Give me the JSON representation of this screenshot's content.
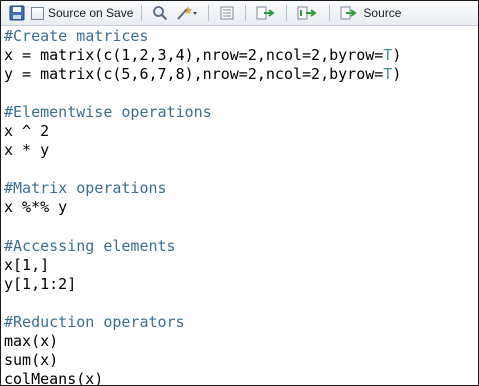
{
  "toolbar": {
    "save_icon": "save-disk-icon",
    "source_on_save_label": "Source on Save",
    "source_on_save_checked": false,
    "search_icon": "magnifier-icon",
    "magic_wand_icon": "magic-wand-icon",
    "outline_icon": "document-outline-icon",
    "run_icon": "run-lines-icon",
    "rerun_icon": "rerun-icon",
    "source_label": "Source"
  },
  "editor": {
    "lines": [
      "#Create matrices",
      "x = matrix(c(1,2,3,4),nrow=2,ncol=2,byrow=T)",
      "y = matrix(c(5,6,7,8),nrow=2,ncol=2,byrow=T)",
      "",
      "#Elementwise operations",
      "x ^ 2",
      "x * y",
      "",
      "#Matrix operations",
      "x %*% y",
      "",
      "#Accessing elements",
      "x[1,]",
      "y[1,1:2]",
      "",
      "#Reduction operators",
      "max(x)",
      "sum(x)",
      "colMeans(x)"
    ]
  },
  "colors": {
    "comment": "#3a6f91",
    "constant": "#3a9a9a",
    "code": "#000000",
    "toolbar_bg": "#e9edf2"
  }
}
